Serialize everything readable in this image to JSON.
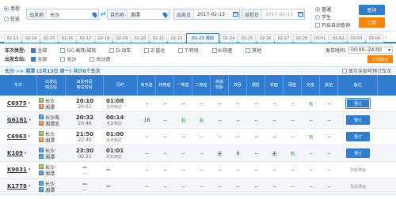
{
  "search": {
    "trip_types": [
      {
        "label": "单程",
        "selected": true
      },
      {
        "label": "往返",
        "selected": false
      }
    ],
    "from_label": "出发地",
    "from_value": "长沙",
    "to_label": "目的地",
    "to_value": "湘潭",
    "depart_label": "出发日",
    "depart_value": "2017-02-13",
    "return_label": "返程日",
    "return_value": "2017-02-13",
    "passenger_types": [
      {
        "label": "普通",
        "selected": true
      },
      {
        "label": "学生",
        "selected": false
      }
    ],
    "auto_query_label": "开启自动查询",
    "query_button": "查询",
    "order_button": "订票"
  },
  "dates": [
    "02-13",
    "02-14",
    "02-15",
    "02-16",
    "02-17",
    "02-18",
    "02-19",
    "02-20",
    "02-21",
    "02-22",
    "02-23 周四",
    "02-24",
    "02-25",
    "02-26",
    "02-27",
    "02-28",
    "03-01",
    "03-02",
    "03-03",
    "03-04"
  ],
  "active_date_index": 10,
  "filters": {
    "type_label": "车次类型:",
    "types": [
      {
        "label": "全部",
        "checked": true
      },
      {
        "label": "GC-高铁/城际",
        "checked": false
      },
      {
        "label": "D-动车",
        "checked": false
      },
      {
        "label": "Z-直达",
        "checked": false
      },
      {
        "label": "T-特快",
        "checked": false
      },
      {
        "label": "K-快速",
        "checked": false
      },
      {
        "label": "其他",
        "checked": false
      }
    ],
    "station_label": "出发车站:",
    "stations": [
      {
        "label": "全部",
        "checked": true
      },
      {
        "label": "长沙",
        "checked": false
      },
      {
        "label": "长沙南",
        "checked": false
      }
    ],
    "time_label": "发车时间:",
    "time_value": "00:00--24:00",
    "sort_button": "订票服务"
  },
  "route": {
    "title": "长沙 --> 湘潭 (2月13日 周一) 共计6个车次",
    "option": "显示全部可预订车次"
  },
  "columns": [
    "车次",
    "出发站\n到达站",
    "出发时间\n到达时间",
    "历时",
    "商务座",
    "特等座",
    "一等座",
    "二等座",
    "高级\n软卧",
    "软卧",
    "硬卧",
    "软座",
    "硬座",
    "无座",
    "其他",
    "备注"
  ],
  "trains": [
    {
      "no": "C6975",
      "from": "长沙",
      "to": "湘潭",
      "from_tag": "始",
      "to_tag": "终",
      "dep": "20:10",
      "arr": "20:51",
      "dur": "01:08",
      "dur_note": "当日到达",
      "seats": [
        "--",
        "--",
        "--",
        "--",
        "--",
        "--",
        "--",
        "--",
        "--",
        "有",
        "--"
      ],
      "action": "预订"
    },
    {
      "no": "G6161",
      "from": "长沙南",
      "to": "湘潭北",
      "from_tag": "过",
      "to_tag": "终",
      "dep": "20:32",
      "arr": "20:46",
      "dur": "00:14",
      "dur_note": "当日到达",
      "seats": [
        "16",
        "--",
        "有",
        "有",
        "--",
        "--",
        "--",
        "--",
        "--",
        "--",
        "--"
      ],
      "action": "预订"
    },
    {
      "no": "C6963",
      "from": "长沙",
      "to": "湘潭",
      "from_tag": "始",
      "to_tag": "终",
      "dep": "21:50",
      "arr": "22:40",
      "dur": "01:00",
      "dur_note": "当日到达",
      "seats": [
        "--",
        "--",
        "--",
        "--",
        "--",
        "--",
        "--",
        "--",
        "--",
        "有",
        "--"
      ],
      "action": "预订"
    },
    {
      "no": "K109",
      "from": "长沙",
      "to": "湘潭",
      "from_tag": "过",
      "to_tag": "过",
      "dep": "23:30",
      "arr": "00:21",
      "dur": "01:01",
      "dur_note": "次日到达",
      "seats": [
        "--",
        "--",
        "--",
        "--",
        "无",
        "6",
        "--",
        "无",
        "有",
        "--",
        "--"
      ],
      "action": "预订"
    },
    {
      "no": "K9031",
      "from": "长沙",
      "to": "湘潭",
      "from_tag": "始",
      "to_tag": "过",
      "dep": "--",
      "arr": "--",
      "dur": "--",
      "dur_note": "",
      "seats": [
        "--",
        "--",
        "--",
        "--",
        "--",
        "--",
        "--",
        "--",
        "--",
        "--",
        "--"
      ],
      "action": "列车停运"
    },
    {
      "no": "K1779",
      "from": "长沙",
      "to": "湘潭",
      "from_tag": "过",
      "to_tag": "过",
      "dep": "--",
      "arr": "--",
      "dur": "--",
      "dur_note": "",
      "seats": [
        "--",
        "--",
        "--",
        "--",
        "--",
        "--",
        "--",
        "--",
        "--",
        "--",
        "--"
      ],
      "action": "列车停运"
    }
  ],
  "colors": {
    "accent": "#2f7cd0",
    "orange": "#fc8302",
    "available": "#29a33b"
  }
}
